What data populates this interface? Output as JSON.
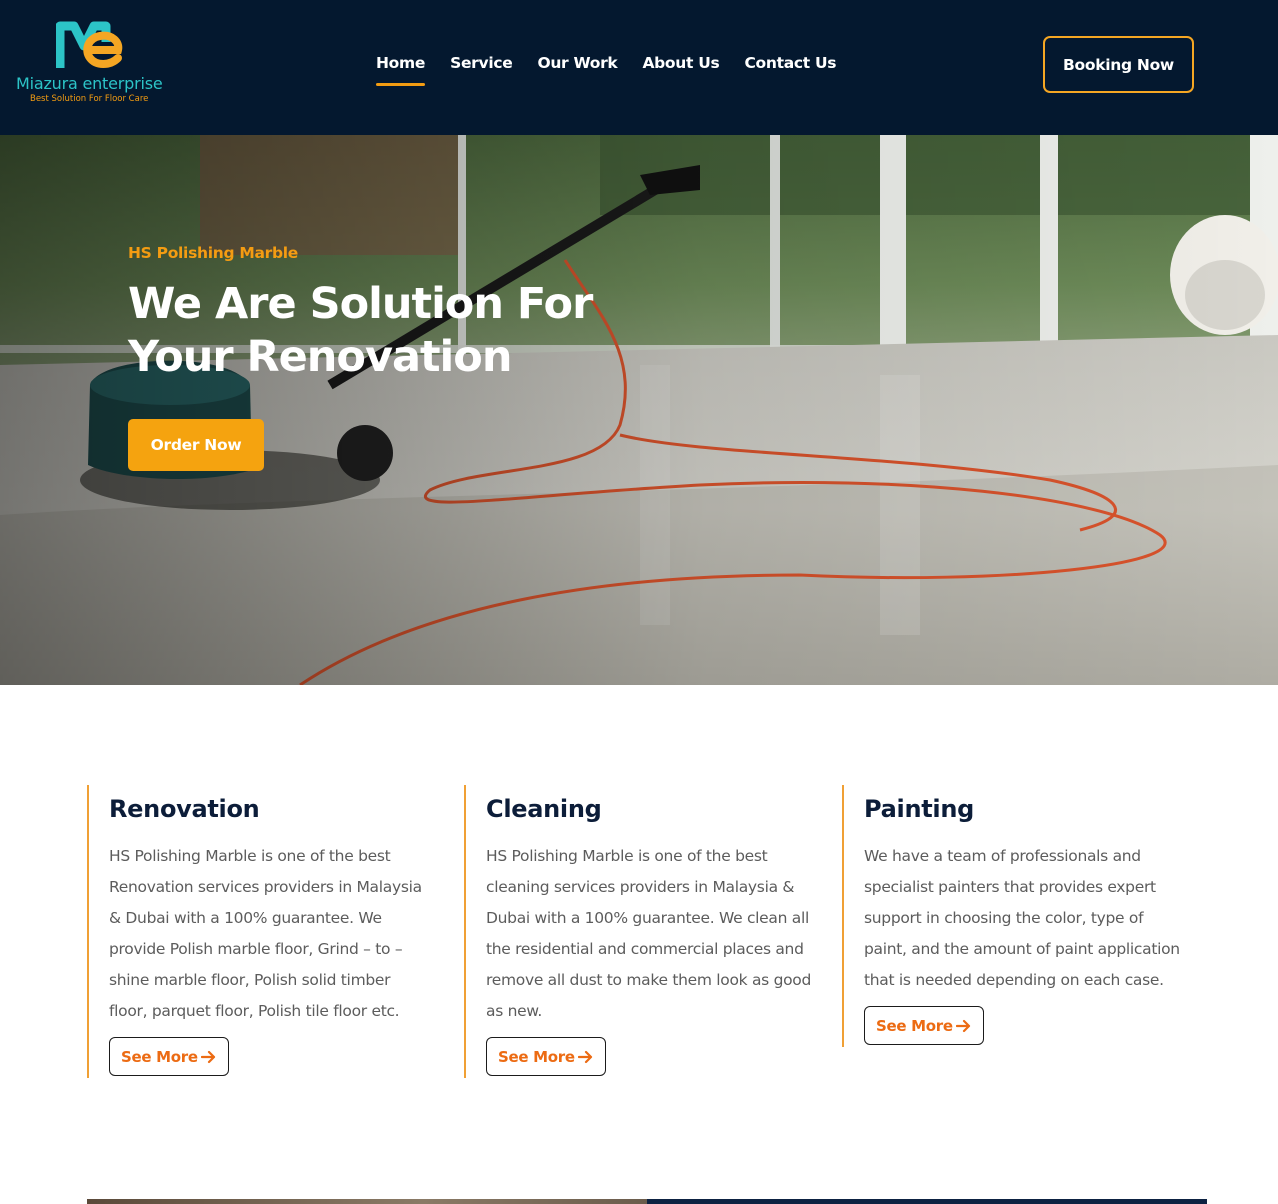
{
  "brand": {
    "name": "Miazura enterprise",
    "tagline": "Best Solution For Floor Care",
    "colors": {
      "navy": "#04182f",
      "teal": "#2cc4c7",
      "orange": "#f39c12",
      "accent_text": "#ec6b13"
    }
  },
  "nav": {
    "items": [
      {
        "label": "Home",
        "active": true
      },
      {
        "label": "Service",
        "active": false
      },
      {
        "label": "Our Work",
        "active": false
      },
      {
        "label": "About Us",
        "active": false
      },
      {
        "label": "Contact Us",
        "active": false
      }
    ],
    "booking_label": "Booking Now"
  },
  "hero": {
    "eyebrow": "HS Polishing Marble",
    "title": "We Are Solution For Your Renovation",
    "cta_label": "Order Now"
  },
  "services": [
    {
      "title": "Renovation",
      "description": "HS Polishing Marble is one of the best Renovation services providers in Malaysia & Dubai with a 100% guarantee. We provide Polish marble floor, Grind – to – shine marble floor, Polish solid timber floor, parquet floor, Polish tile floor etc.",
      "button_label": "See More",
      "icon": "arrow-right-icon"
    },
    {
      "title": "Cleaning",
      "description": "HS Polishing Marble is one of the best cleaning services providers in Malaysia & Dubai with a 100% guarantee. We clean all the residential and commercial places and remove all dust to make them look as good as new.",
      "button_label": "See More",
      "icon": "arrow-right-icon"
    },
    {
      "title": "Painting",
      "description": "We have a team of professionals and specialist painters that provides expert support in choosing the color, type of paint, and the amount of paint application that is needed depending on each case.",
      "button_label": "See More",
      "icon": "arrow-right-icon"
    }
  ]
}
